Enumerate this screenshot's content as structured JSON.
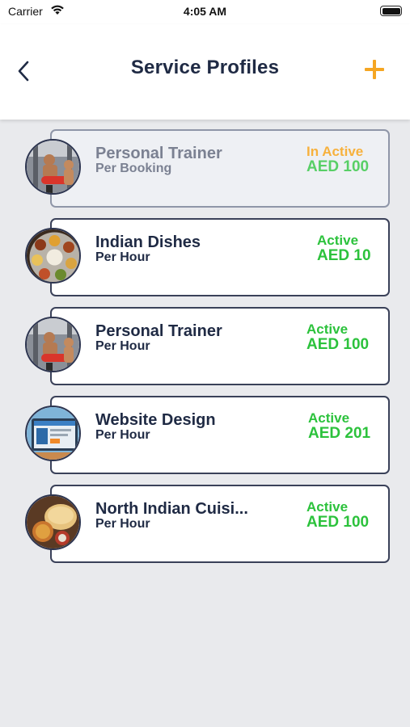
{
  "status_bar": {
    "carrier": "Carrier",
    "time": "4:05 AM"
  },
  "header": {
    "title": "Service Profiles",
    "back_icon": "chevron-left-icon",
    "add_icon": "plus-icon",
    "accent_color": "#f5a623"
  },
  "profiles": [
    {
      "title": "Personal Trainer",
      "rate": "Per Booking",
      "status": "In Active",
      "price": "AED 100",
      "image": "trainer-photo"
    },
    {
      "title": "Indian Dishes",
      "rate": "Per Hour",
      "status": "Active",
      "price": "AED 10",
      "image": "indian-thali-photo"
    },
    {
      "title": "Personal Trainer",
      "rate": "Per Hour",
      "status": "Active",
      "price": "AED 100",
      "image": "trainer-photo"
    },
    {
      "title": "Website Design",
      "rate": "Per Hour",
      "status": "Active",
      "price": "AED 201",
      "image": "website-design-photo"
    },
    {
      "title": "North Indian Cuisi...",
      "rate": "Per Hour",
      "status": "Active",
      "price": "AED 100",
      "image": "north-indian-food-photo"
    }
  ],
  "colors": {
    "active": "#2cc23c",
    "inactive": "#f7b13d",
    "text": "#1f2a44"
  }
}
